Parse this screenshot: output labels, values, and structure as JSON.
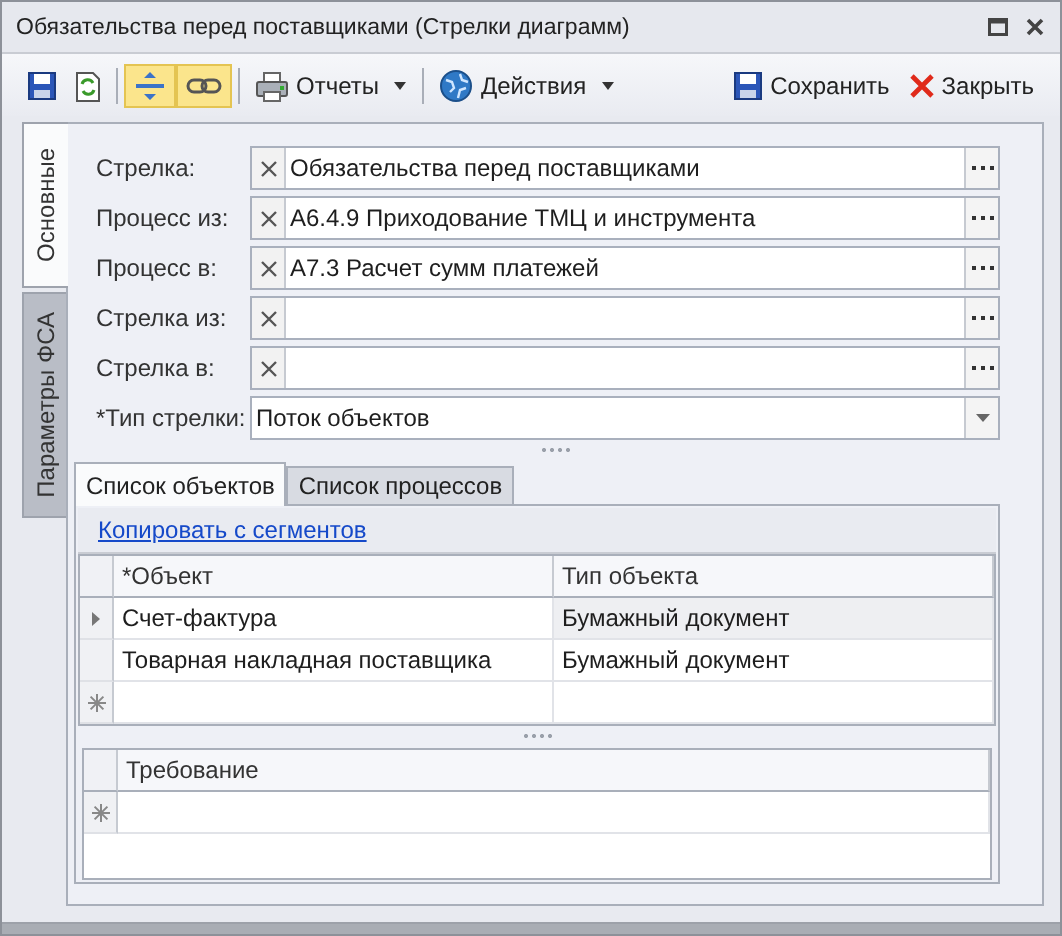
{
  "window": {
    "title": "Обязательства перед поставщиками (Стрелки диаграмм)"
  },
  "toolbar": {
    "items": [
      {
        "kind": "icon",
        "on": false
      },
      {
        "kind": "icon",
        "on": false
      },
      {
        "kind": "separator"
      },
      {
        "kind": "icon",
        "on": true
      },
      {
        "kind": "icon",
        "on": true
      },
      {
        "kind": "separator"
      },
      {
        "kind": "dropdown",
        "label": "Отчеты"
      },
      {
        "kind": "separator"
      },
      {
        "kind": "dropdown",
        "label": "Действия"
      },
      {
        "kind": "spacer"
      },
      {
        "kind": "button",
        "label": "Сохранить"
      },
      {
        "kind": "button",
        "label": "Закрыть"
      }
    ]
  },
  "side_tabs": [
    {
      "label": "Основные",
      "selected": true
    },
    {
      "label": "Параметры ФСА",
      "selected": false
    }
  ],
  "fields": [
    {
      "kind": "lookup",
      "label": "Стрелка:",
      "value": "Обязательства перед поставщиками"
    },
    {
      "kind": "lookup",
      "label": "Процесс из:",
      "value": "А6.4.9 Приходование ТМЦ и инструмента"
    },
    {
      "kind": "lookup",
      "label": "Процесс в:",
      "value": "А7.3 Расчет сумм платежей"
    },
    {
      "kind": "lookup",
      "label": "Стрелка из:"
    },
    {
      "kind": "lookup",
      "label": "Стрелка в:"
    },
    {
      "kind": "combo",
      "label": "*Тип стрелки:",
      "value": "Поток объектов"
    }
  ],
  "detail_tabs": [
    {
      "label": "Список объектов",
      "selected": true
    },
    {
      "label": "Список процессов",
      "selected": false
    }
  ],
  "link": "Копировать с сегментов",
  "objects_grid": {
    "columns": [
      "*Объект",
      "Тип объекта"
    ],
    "rows": [
      {
        "cells": [
          "Счет-фактура",
          "Бумажный документ"
        ],
        "selected": true
      },
      {
        "cells": [
          "Товарная накладная поставщика",
          "Бумажный документ"
        ],
        "selected": false
      }
    ]
  },
  "requirements_grid": {
    "columns": [
      "Требование"
    ]
  }
}
